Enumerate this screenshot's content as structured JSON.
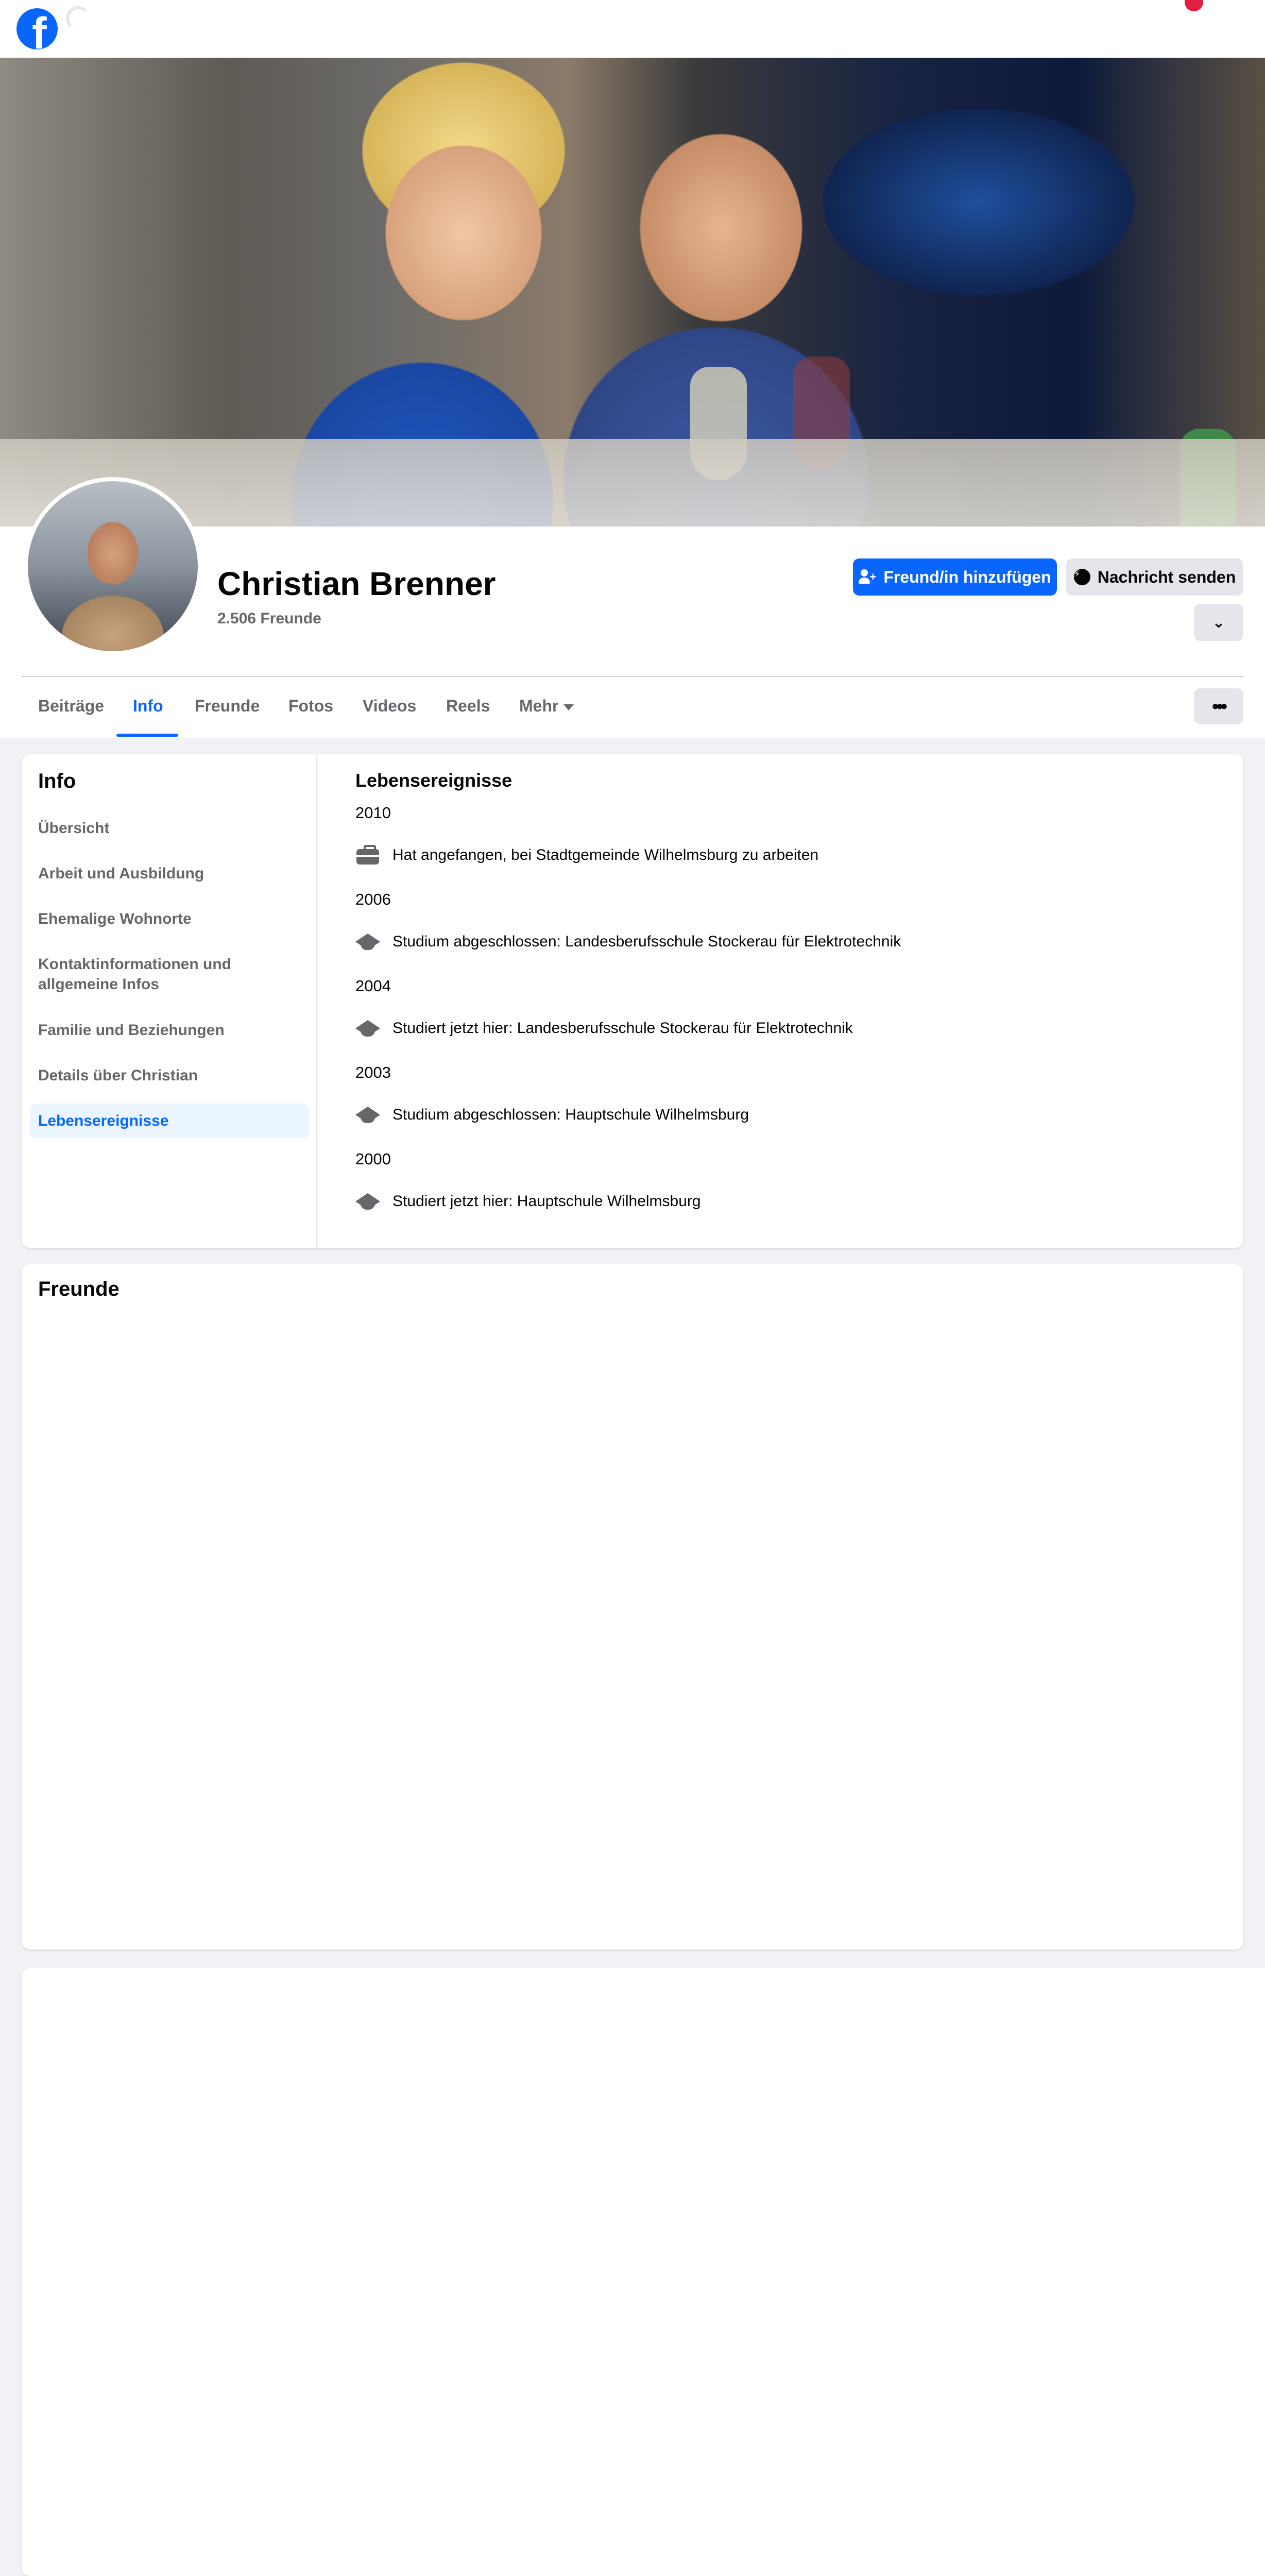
{
  "profile": {
    "name": "Christian Brenner",
    "friends_count": "2.506 Freunde"
  },
  "actions": {
    "add_friend": "Freund/in hinzufügen",
    "send_message": "Nachricht senden"
  },
  "tabs": [
    {
      "label": "Beiträge"
    },
    {
      "label": "Info"
    },
    {
      "label": "Freunde"
    },
    {
      "label": "Fotos"
    },
    {
      "label": "Videos"
    },
    {
      "label": "Reels"
    },
    {
      "label": "Mehr"
    }
  ],
  "info": {
    "title": "Info",
    "nav": [
      {
        "label": "Übersicht"
      },
      {
        "label": "Arbeit und Ausbildung"
      },
      {
        "label": "Ehemalige Wohnorte"
      },
      {
        "label": "Kontaktinformationen und allgemeine Infos"
      },
      {
        "label": "Familie und Beziehungen"
      },
      {
        "label": "Details über Christian"
      },
      {
        "label": "Lebensereignisse"
      }
    ],
    "active_nav": "Lebensereignisse"
  },
  "life_events": {
    "title": "Lebensereignisse",
    "items": [
      {
        "year": "2010",
        "icon": "briefcase-icon",
        "text": "Hat angefangen, bei Stadtgemeinde Wilhelmsburg zu arbeiten"
      },
      {
        "year": "2006",
        "icon": "graduation-cap-icon",
        "text": "Studium abgeschlossen: Landesberufsschule Stockerau für Elektrotechnik"
      },
      {
        "year": "2004",
        "icon": "graduation-cap-icon",
        "text": "Studiert jetzt hier: Landesberufsschule Stockerau für Elektrotechnik"
      },
      {
        "year": "2003",
        "icon": "graduation-cap-icon",
        "text": "Studium abgeschlossen: Hauptschule Wilhelmsburg"
      },
      {
        "year": "2000",
        "icon": "graduation-cap-icon",
        "text": "Studiert jetzt hier: Hauptschule Wilhelmsburg"
      }
    ]
  },
  "friends_section": {
    "title": "Freunde"
  },
  "colors": {
    "brand_blue": "#0866ff",
    "background": "#f0f2f5",
    "secondary_button": "#e4e6eb",
    "muted_text": "#65676b",
    "notification_red": "#e41e3f"
  }
}
